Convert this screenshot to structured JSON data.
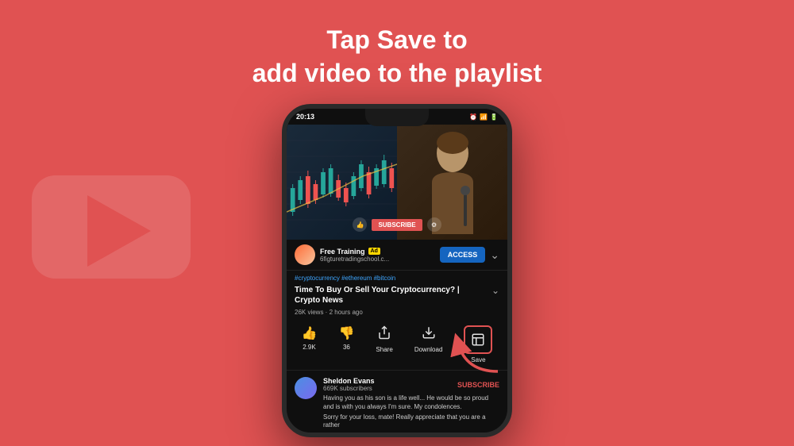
{
  "background": {
    "color": "#e05252"
  },
  "header": {
    "line1": "Tap Save to",
    "line2": "add video to the playlist"
  },
  "statusBar": {
    "time": "20:13",
    "icons": "🔔 📡 📶 🔋"
  },
  "adBar": {
    "title": "Free Training",
    "badge": "Ad",
    "channel": "6figturetradingschool.c...",
    "accessLabel": "ACCESS"
  },
  "hashtags": "#cryptocurrency #ethereum #bitcoin",
  "videoTitle": "Time To Buy Or Sell Your Cryptocurrency? | Crypto News",
  "videoMeta": "26K views · 2 hours ago",
  "actions": {
    "like": {
      "icon": "👍",
      "count": "2.9K"
    },
    "dislike": {
      "icon": "👎",
      "count": "36"
    },
    "share": {
      "icon": "↗",
      "label": "Share"
    },
    "download": {
      "icon": "⬇",
      "label": "Download"
    },
    "save": {
      "icon": "⊞",
      "label": "Save"
    }
  },
  "comment": {
    "name": "Sheldon Evans",
    "subs": "669K subscribers",
    "text": "Having you as his son is a life well... He would be so proud and is with you always I'm sure. My condolences.",
    "text2": "Sorry for your loss, mate! Really appreciate that you are a rather",
    "subscribeLabel": "SUBSCRIBE"
  }
}
